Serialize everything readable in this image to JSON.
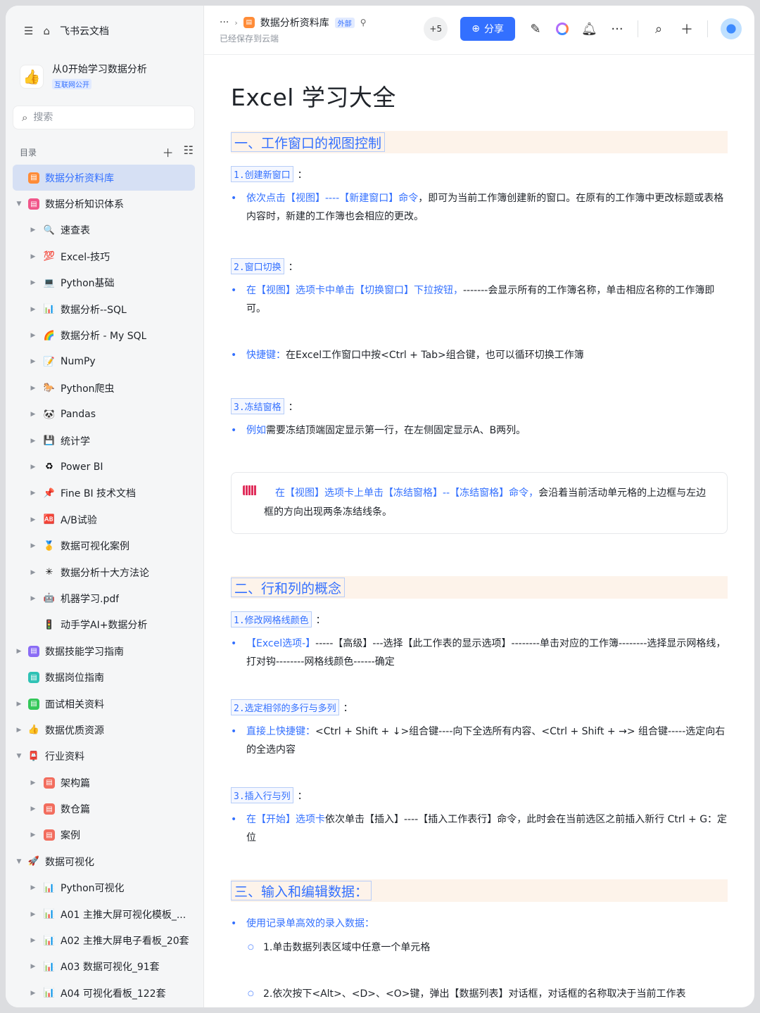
{
  "app": {
    "brand": "飞书云文档"
  },
  "space": {
    "name": "从0开始学习数据分析",
    "tag": "互联网公开",
    "emoji": "👍"
  },
  "search": {
    "placeholder": "搜索"
  },
  "toc": {
    "label": "目录"
  },
  "tree": [
    {
      "label": "数据分析资料库",
      "level": 0,
      "arrow": "",
      "icon": "doc-orange",
      "active": true
    },
    {
      "label": "数据分析知识体系",
      "level": 0,
      "arrow": "▼",
      "icon": "doc-pink"
    },
    {
      "label": "速查表",
      "level": 1,
      "arrow": "▶",
      "icon": "🔍"
    },
    {
      "label": "Excel-技巧",
      "level": 1,
      "arrow": "▶",
      "icon": "💯"
    },
    {
      "label": "Python基础",
      "level": 1,
      "arrow": "▶",
      "icon": "💻"
    },
    {
      "label": "数据分析--SQL",
      "level": 1,
      "arrow": "▶",
      "icon": "📊"
    },
    {
      "label": "数据分析 - My SQL",
      "level": 1,
      "arrow": "▶",
      "icon": "🌈"
    },
    {
      "label": "NumPy",
      "level": 1,
      "arrow": "▶",
      "icon": "📝"
    },
    {
      "label": "Python爬虫",
      "level": 1,
      "arrow": "▶",
      "icon": "🐎"
    },
    {
      "label": "Pandas",
      "level": 1,
      "arrow": "▶",
      "icon": "🐼"
    },
    {
      "label": "统计学",
      "level": 1,
      "arrow": "▶",
      "icon": "💾"
    },
    {
      "label": "Power BI",
      "level": 1,
      "arrow": "▶",
      "icon": "♻"
    },
    {
      "label": "Fine BI 技术文档",
      "level": 1,
      "arrow": "▶",
      "icon": "📌"
    },
    {
      "label": "A/B试验",
      "level": 1,
      "arrow": "▶",
      "icon": "🆎"
    },
    {
      "label": "数据可视化案例",
      "level": 1,
      "arrow": "▶",
      "icon": "🥇"
    },
    {
      "label": "数据分析十大方法论",
      "level": 1,
      "arrow": "▶",
      "icon": "✳"
    },
    {
      "label": "机器学习.pdf",
      "level": 1,
      "arrow": "▶",
      "icon": "🤖"
    },
    {
      "label": "动手学AI+数据分析",
      "level": 1,
      "arrow": "",
      "icon": "🚦"
    },
    {
      "label": "数据技能学习指南",
      "level": 0,
      "arrow": "▶",
      "icon": "doc-purple"
    },
    {
      "label": "数据岗位指南",
      "level": 0,
      "arrow": "",
      "icon": "doc-teal"
    },
    {
      "label": "面试相关资料",
      "level": 0,
      "arrow": "▶",
      "icon": "doc-green"
    },
    {
      "label": "数据优质资源",
      "level": 0,
      "arrow": "▶",
      "icon": "👍"
    },
    {
      "label": "行业资料",
      "level": 0,
      "arrow": "▼",
      "icon": "📮"
    },
    {
      "label": "架构篇",
      "level": 1,
      "arrow": "▶",
      "icon": "doc-red"
    },
    {
      "label": "数仓篇",
      "level": 1,
      "arrow": "▶",
      "icon": "doc-red"
    },
    {
      "label": "案例",
      "level": 1,
      "arrow": "▶",
      "icon": "doc-red"
    },
    {
      "label": "数据可视化",
      "level": 0,
      "arrow": "▼",
      "icon": "🚀"
    },
    {
      "label": "Python可视化",
      "level": 1,
      "arrow": "▶",
      "icon": "📊"
    },
    {
      "label": "A01 主推大屏可视化模板_...",
      "level": 1,
      "arrow": "▶",
      "icon": "📊"
    },
    {
      "label": "A02 主推大屏电子看板_20套",
      "level": 1,
      "arrow": "▶",
      "icon": "📊"
    },
    {
      "label": "A03 数据可视化_91套",
      "level": 1,
      "arrow": "▶",
      "icon": "📊"
    },
    {
      "label": "A04 可视化看板_122套",
      "level": 1,
      "arrow": "▶",
      "icon": "📊"
    }
  ],
  "topbar": {
    "dots": "···",
    "doc_name": "数据分析资料库",
    "ext_tag": "外部",
    "saved": "已经保存到云端",
    "collaborators": "+5",
    "share": "分享"
  },
  "doc": {
    "title": "Excel 学习大全",
    "s1": {
      "heading": "一、工作窗口的视图控制",
      "h1": "1.创建新窗口",
      "b1_blue": "依次点击【视图】----【新建窗口】命令",
      "b1_rest": "，即可为当前工作簿创建新的窗口。在原有的工作簿中更改标题或表格内容时，新建的工作簿也会相应的更改。",
      "h2": "2.窗口切换",
      "b2_blue": "在【视图】选项卡中单击【切换窗口】下拉按钮，",
      "b2_rest": "-------会显示所有的工作簿名称，单击相应名称的工作簿即可。",
      "b3_blue": "快捷键：",
      "b3_rest": "在Excel工作窗口中按<Ctrl + Tab>组合键，也可以循环切换工作簿",
      "h3": "3.冻结窗格",
      "b4_blue": "例如",
      "b4_rest": "需要冻结顶端固定显示第一行，在左侧固定显示A、B两列。",
      "callout_blue": "在【视图】选项卡上单击【冻结窗格】--【冻结窗格】命令，",
      "callout_rest": "会沿着当前活动单元格的上边框与左边框的方向出现两条冻结线条。"
    },
    "s2": {
      "heading": "二、行和列的概念",
      "h1": "1.修改网格线颜色",
      "b1_blue": "【Excel选项-】",
      "b1_rest": "-----【高级】---选择【此工作表的显示选项】--------单击对应的工作簿--------选择显示网格线，打对钩--------网格线颜色------确定",
      "h2": "2.选定相邻的多行与多列",
      "b2_blue": "直接上快捷键：",
      "b2_rest": "<Ctrl + Shift + ↓>组合键----向下全选所有内容、<Ctrl + Shift + →> 组合键-----选定向右的全选内容",
      "h3": "3.插入行与列",
      "b3_blue": "在【开始】选项卡",
      "b3_rest": "依次单击【插入】----【插入工作表行】命令，此时会在当前选区之前插入新行 Ctrl + G：定位"
    },
    "s3": {
      "heading": "三、输入和编辑数据：",
      "b1_blue": "使用记录单高效的录入数据：",
      "sub1": "1.单击数据列表区域中任意一个单元格",
      "sub2": "2.依次按下<Alt>、<D>、<O>键，弹出【数据列表】对话框，对话框的名称取决于当前工作表"
    }
  }
}
